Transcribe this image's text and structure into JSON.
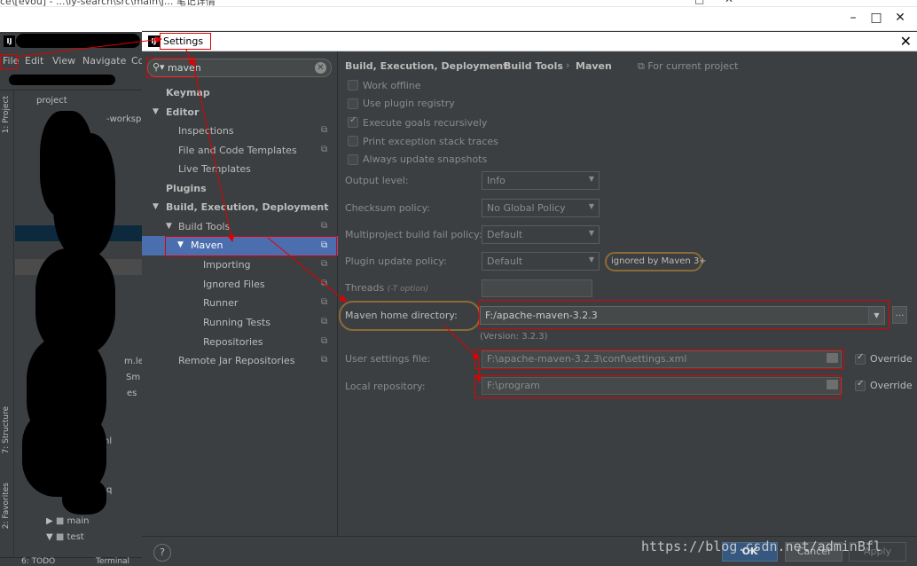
{
  "window": {
    "ide_title": "ce\\[evou] - ...\\ly-search\\src\\main\\j... 笔记详情"
  },
  "ide": {
    "logo": "IJ",
    "menu": [
      "File",
      "Edit",
      "View",
      "Navigate",
      "Co"
    ],
    "side_tabs": {
      "project": "1: Project",
      "structure": "7: Structure",
      "favorites": "2: Favorites"
    },
    "panel_title": "project",
    "tree_fragment": "-worksp",
    "tree_items": [
      "main",
      "test"
    ],
    "fragments": [
      "m.le",
      "Sm",
      "es",
      "nl",
      "q"
    ],
    "bottom_tabs": [
      "6: TODO",
      "Terminal"
    ]
  },
  "dialog": {
    "logo": "IJ",
    "title": "Settings",
    "search": {
      "value": "maven",
      "placeholder": ""
    },
    "nav": [
      {
        "label": "Keymap",
        "bold": true
      },
      {
        "label": "Editor",
        "bold": true
      },
      {
        "label": "Inspections"
      },
      {
        "label": "File and Code Templates"
      },
      {
        "label": "Live Templates"
      },
      {
        "label": "Plugins",
        "bold": true
      },
      {
        "label": "Build, Execution, Deployment",
        "bold": true
      },
      {
        "label": "Build Tools"
      },
      {
        "label": "Maven",
        "selected": true
      },
      {
        "label": "Importing"
      },
      {
        "label": "Ignored Files"
      },
      {
        "label": "Runner"
      },
      {
        "label": "Running Tests"
      },
      {
        "label": "Repositories"
      },
      {
        "label": "Remote Jar Repositories"
      }
    ],
    "breadcrumb": [
      "Build, Execution, Deployment",
      "Build Tools",
      "Maven"
    ],
    "for_project": "For current project",
    "checkboxes": [
      {
        "label": "Work offline",
        "checked": false
      },
      {
        "label": "Use plugin registry",
        "checked": false
      },
      {
        "label": "Execute goals recursively",
        "checked": true
      },
      {
        "label": "Print exception stack traces",
        "checked": false
      },
      {
        "label": "Always update snapshots",
        "checked": false
      }
    ],
    "fields": {
      "output_level": {
        "label": "Output level:",
        "value": "Info"
      },
      "checksum_policy": {
        "label": "Checksum policy:",
        "value": "No Global Policy"
      },
      "multiproject_policy": {
        "label": "Multiproject build fail policy:",
        "value": "Default"
      },
      "plugin_update_policy": {
        "label": "Plugin update policy:",
        "value": "Default"
      },
      "plugin_tooltip": "ignored by Maven 3+",
      "threads": {
        "label": "Threads",
        "hint": "(-T option)",
        "value": ""
      },
      "maven_home": {
        "label": "Maven home directory:",
        "value": "F:/apache-maven-3.2.3",
        "version": "(Version: 3.2.3)"
      },
      "user_settings": {
        "label": "User settings file:",
        "value": "F:\\apache-maven-3.2.3\\conf\\settings.xml",
        "override": "Override"
      },
      "local_repo": {
        "label": "Local repository:",
        "value": "F:\\program",
        "override": "Override"
      }
    },
    "buttons": {
      "help": "?",
      "ok": "OK",
      "cancel": "Cancel",
      "apply": "Apply"
    }
  },
  "watermark": "https://blog.csdn.net/adminBfl",
  "colors": {
    "annotation_red": "#e00000",
    "selection_blue": "#4b6eaf",
    "dark_bg": "#3c3f41",
    "highlight_outline": "#8c6a36"
  }
}
